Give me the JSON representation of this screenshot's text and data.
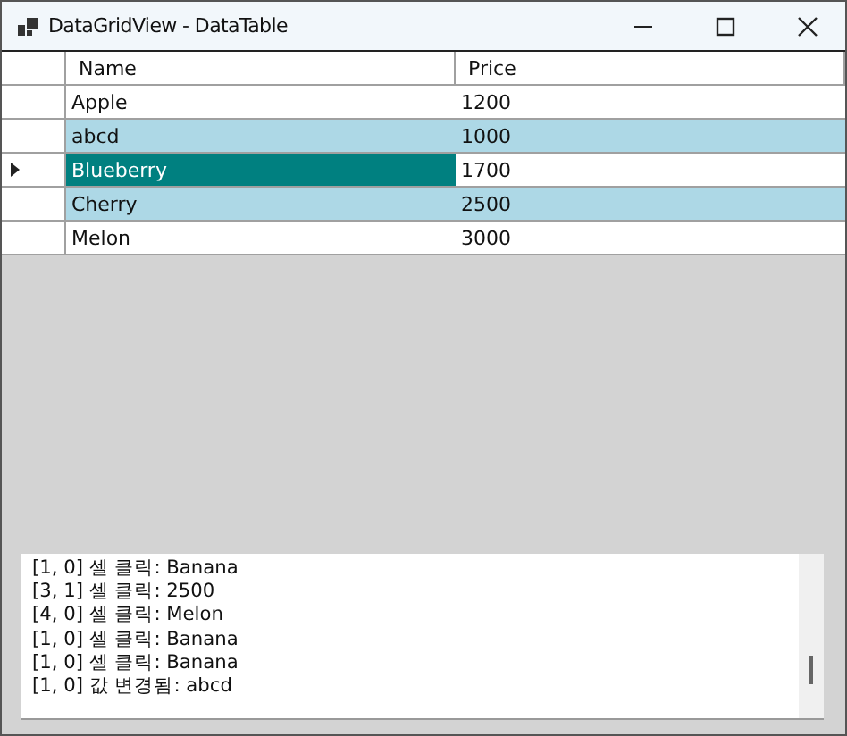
{
  "window": {
    "title": "DataGridView - DataTable"
  },
  "table": {
    "columns": [
      "Name",
      "Price"
    ],
    "rows": [
      {
        "current": false,
        "cells": [
          {
            "text": "Apple",
            "selected": false
          },
          {
            "text": "1200",
            "selected": false
          }
        ]
      },
      {
        "current": false,
        "cells": [
          {
            "text": "abcd",
            "selected": false
          },
          {
            "text": "1000",
            "selected": false
          }
        ]
      },
      {
        "current": true,
        "cells": [
          {
            "text": "Blueberry",
            "selected": true
          },
          {
            "text": "1700",
            "selected": false
          }
        ]
      },
      {
        "current": false,
        "cells": [
          {
            "text": "Cherry",
            "selected": false
          },
          {
            "text": "2500",
            "selected": false
          }
        ]
      },
      {
        "current": false,
        "cells": [
          {
            "text": "Melon",
            "selected": false
          },
          {
            "text": "3000",
            "selected": false
          }
        ]
      }
    ]
  },
  "log": [
    "[1, 0] 셀 클릭: Banana",
    "[3, 1] 셀 클릭: 2500",
    "[4, 0] 셀 클릭: Melon",
    "[1, 0] 셀 클릭: Banana",
    "[1, 0] 셀 클릭: Banana",
    "[1, 0] 값 변경됨: abcd"
  ]
}
